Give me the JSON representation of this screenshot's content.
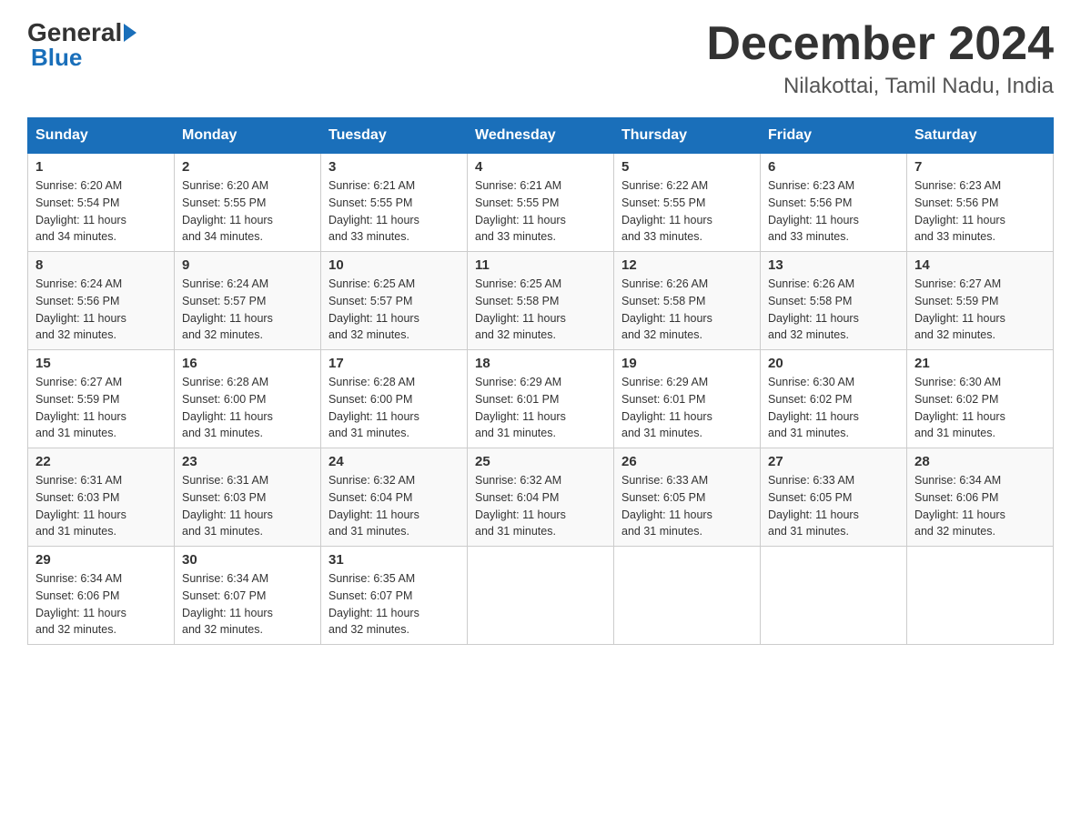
{
  "header": {
    "logo_general": "General",
    "logo_blue": "Blue",
    "month_title": "December 2024",
    "location": "Nilakottai, Tamil Nadu, India"
  },
  "weekdays": [
    "Sunday",
    "Monday",
    "Tuesday",
    "Wednesday",
    "Thursday",
    "Friday",
    "Saturday"
  ],
  "weeks": [
    [
      {
        "day": "1",
        "sunrise": "6:20 AM",
        "sunset": "5:54 PM",
        "daylight": "11 hours and 34 minutes."
      },
      {
        "day": "2",
        "sunrise": "6:20 AM",
        "sunset": "5:55 PM",
        "daylight": "11 hours and 34 minutes."
      },
      {
        "day": "3",
        "sunrise": "6:21 AM",
        "sunset": "5:55 PM",
        "daylight": "11 hours and 33 minutes."
      },
      {
        "day": "4",
        "sunrise": "6:21 AM",
        "sunset": "5:55 PM",
        "daylight": "11 hours and 33 minutes."
      },
      {
        "day": "5",
        "sunrise": "6:22 AM",
        "sunset": "5:55 PM",
        "daylight": "11 hours and 33 minutes."
      },
      {
        "day": "6",
        "sunrise": "6:23 AM",
        "sunset": "5:56 PM",
        "daylight": "11 hours and 33 minutes."
      },
      {
        "day": "7",
        "sunrise": "6:23 AM",
        "sunset": "5:56 PM",
        "daylight": "11 hours and 33 minutes."
      }
    ],
    [
      {
        "day": "8",
        "sunrise": "6:24 AM",
        "sunset": "5:56 PM",
        "daylight": "11 hours and 32 minutes."
      },
      {
        "day": "9",
        "sunrise": "6:24 AM",
        "sunset": "5:57 PM",
        "daylight": "11 hours and 32 minutes."
      },
      {
        "day": "10",
        "sunrise": "6:25 AM",
        "sunset": "5:57 PM",
        "daylight": "11 hours and 32 minutes."
      },
      {
        "day": "11",
        "sunrise": "6:25 AM",
        "sunset": "5:58 PM",
        "daylight": "11 hours and 32 minutes."
      },
      {
        "day": "12",
        "sunrise": "6:26 AM",
        "sunset": "5:58 PM",
        "daylight": "11 hours and 32 minutes."
      },
      {
        "day": "13",
        "sunrise": "6:26 AM",
        "sunset": "5:58 PM",
        "daylight": "11 hours and 32 minutes."
      },
      {
        "day": "14",
        "sunrise": "6:27 AM",
        "sunset": "5:59 PM",
        "daylight": "11 hours and 32 minutes."
      }
    ],
    [
      {
        "day": "15",
        "sunrise": "6:27 AM",
        "sunset": "5:59 PM",
        "daylight": "11 hours and 31 minutes."
      },
      {
        "day": "16",
        "sunrise": "6:28 AM",
        "sunset": "6:00 PM",
        "daylight": "11 hours and 31 minutes."
      },
      {
        "day": "17",
        "sunrise": "6:28 AM",
        "sunset": "6:00 PM",
        "daylight": "11 hours and 31 minutes."
      },
      {
        "day": "18",
        "sunrise": "6:29 AM",
        "sunset": "6:01 PM",
        "daylight": "11 hours and 31 minutes."
      },
      {
        "day": "19",
        "sunrise": "6:29 AM",
        "sunset": "6:01 PM",
        "daylight": "11 hours and 31 minutes."
      },
      {
        "day": "20",
        "sunrise": "6:30 AM",
        "sunset": "6:02 PM",
        "daylight": "11 hours and 31 minutes."
      },
      {
        "day": "21",
        "sunrise": "6:30 AM",
        "sunset": "6:02 PM",
        "daylight": "11 hours and 31 minutes."
      }
    ],
    [
      {
        "day": "22",
        "sunrise": "6:31 AM",
        "sunset": "6:03 PM",
        "daylight": "11 hours and 31 minutes."
      },
      {
        "day": "23",
        "sunrise": "6:31 AM",
        "sunset": "6:03 PM",
        "daylight": "11 hours and 31 minutes."
      },
      {
        "day": "24",
        "sunrise": "6:32 AM",
        "sunset": "6:04 PM",
        "daylight": "11 hours and 31 minutes."
      },
      {
        "day": "25",
        "sunrise": "6:32 AM",
        "sunset": "6:04 PM",
        "daylight": "11 hours and 31 minutes."
      },
      {
        "day": "26",
        "sunrise": "6:33 AM",
        "sunset": "6:05 PM",
        "daylight": "11 hours and 31 minutes."
      },
      {
        "day": "27",
        "sunrise": "6:33 AM",
        "sunset": "6:05 PM",
        "daylight": "11 hours and 31 minutes."
      },
      {
        "day": "28",
        "sunrise": "6:34 AM",
        "sunset": "6:06 PM",
        "daylight": "11 hours and 32 minutes."
      }
    ],
    [
      {
        "day": "29",
        "sunrise": "6:34 AM",
        "sunset": "6:06 PM",
        "daylight": "11 hours and 32 minutes."
      },
      {
        "day": "30",
        "sunrise": "6:34 AM",
        "sunset": "6:07 PM",
        "daylight": "11 hours and 32 minutes."
      },
      {
        "day": "31",
        "sunrise": "6:35 AM",
        "sunset": "6:07 PM",
        "daylight": "11 hours and 32 minutes."
      },
      null,
      null,
      null,
      null
    ]
  ],
  "labels": {
    "sunrise": "Sunrise:",
    "sunset": "Sunset:",
    "daylight": "Daylight:"
  }
}
